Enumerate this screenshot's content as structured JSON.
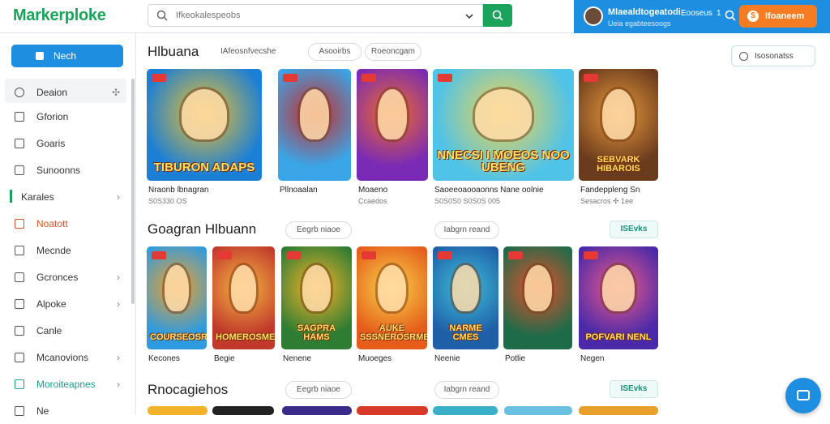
{
  "header": {
    "logo": "Markerploke",
    "search_placeholder": "Ifkeokalespeobs",
    "user_name": "Mlaealdtogeatodi",
    "user_sub": "Ueia egabteesoogs",
    "user_status": "Eooseus",
    "user_count": "1",
    "cta_label": "Ifoaneem"
  },
  "sidebar": {
    "new_button": "Nech",
    "items": [
      {
        "label": "Deaion",
        "icon": "search-icon",
        "arrow": "✣"
      },
      {
        "label": "Gforion",
        "icon": "doc-icon",
        "arrow": ""
      },
      {
        "label": "Goaris",
        "icon": "square-icon",
        "arrow": ""
      },
      {
        "label": "Sunoonns",
        "icon": "calendar-icon",
        "arrow": ""
      },
      {
        "label": "Karales",
        "icon": "folder-icon",
        "arrow": "›"
      },
      {
        "label": "Noatott",
        "icon": "bell-icon",
        "arrow": ""
      },
      {
        "label": "Mecnde",
        "icon": "doc-icon",
        "arrow": ""
      },
      {
        "label": "Gcronces",
        "icon": "list-icon",
        "arrow": "›"
      },
      {
        "label": "Alpoke",
        "icon": "square-icon",
        "arrow": "›"
      },
      {
        "label": "Canle",
        "icon": "chat-icon",
        "arrow": ""
      },
      {
        "label": "Mcanovions",
        "icon": "grid-icon",
        "arrow": "›"
      },
      {
        "label": "Moroiteapnes",
        "icon": "star-icon",
        "arrow": "›"
      },
      {
        "label": "Ne",
        "icon": "doc-icon",
        "arrow": ""
      }
    ]
  },
  "main": {
    "filter_button": "Isosonatss",
    "sections": [
      {
        "title": "Hlbuana",
        "sub": "IAfeosnfvecshe",
        "chips": [
          "Asooirbs",
          "Roeoncgam"
        ],
        "see_all": "",
        "cards": [
          {
            "title": "Nraonb lbnagran",
            "sub": "S0S330 OS",
            "art": "TIBURON ADAPS",
            "colors": [
              "#1b7fd6",
              "#f3c22a"
            ]
          },
          {
            "title": "Pllnoaalan",
            "sub": "",
            "art": "",
            "colors": [
              "#3aa6e8",
              "#c82a2a"
            ]
          },
          {
            "title": "Moaeno",
            "sub": "Ccaedos",
            "art": "",
            "colors": [
              "#7a2bb5",
              "#f06a2a"
            ]
          },
          {
            "title": "Saoeeoaooaonns Nane oolnie",
            "sub": "S0S0S0 S0S0S 005",
            "art": "NNECSI I MOEOS NOO UBENG",
            "colors": [
              "#4fc3e8",
              "#f7d54a"
            ]
          },
          {
            "title": "Fandeppleng Sn",
            "sub": "Sesacros ✣ 1ee",
            "art": "SEBVARK HIBAROIS",
            "colors": [
              "#6b3b1e",
              "#e89a3a"
            ]
          }
        ]
      },
      {
        "title": "Goagran Hlbuann",
        "sub": "",
        "chips": [
          "Eegrb niaoe",
          "Iabgrn reand"
        ],
        "see_all": "ISEvks",
        "cards": [
          {
            "title": "Kecones",
            "sub": "",
            "art": "COURSEOSRIA",
            "colors": [
              "#2e9be0",
              "#f2a12a"
            ]
          },
          {
            "title": "Begie",
            "sub": "",
            "art": "HOMEROSMEISEN",
            "colors": [
              "#c0392b",
              "#f5b642"
            ]
          },
          {
            "title": "Nenene",
            "sub": "",
            "art": "SAGPRA HAMS",
            "colors": [
              "#2f7d32",
              "#f7b32b"
            ]
          },
          {
            "title": "Muoeges",
            "sub": "",
            "art": "AUKE SSSNEROSRMEOSY",
            "colors": [
              "#e65c1a",
              "#f7d54a"
            ]
          },
          {
            "title": "Neenie",
            "sub": "",
            "art": "NARME CMES",
            "colors": [
              "#1f5fa8",
              "#3ec0d9"
            ]
          },
          {
            "title": "Potlie",
            "sub": "",
            "art": "",
            "colors": [
              "#1e6b4a",
              "#e6502a"
            ]
          },
          {
            "title": "Negen",
            "sub": "",
            "art": "POFVARI NENL",
            "colors": [
              "#4a2aa8",
              "#f05a8a"
            ]
          }
        ]
      },
      {
        "title": "Rnocagiehos",
        "sub": "",
        "chips": [
          "Eegrb niaoe",
          "Iabgrn reand"
        ],
        "see_all": "ISEvks",
        "cards": []
      }
    ]
  }
}
